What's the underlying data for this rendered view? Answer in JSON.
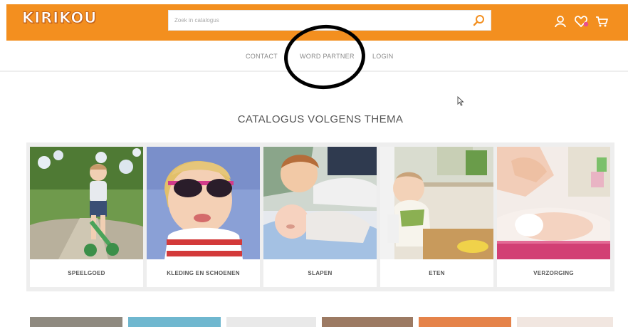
{
  "header": {
    "logo_text": "KIRIKOU",
    "search": {
      "placeholder": "Zoek in catalogus",
      "value": ""
    },
    "icons": [
      "search-icon",
      "user-icon",
      "heart-icon",
      "cart-icon"
    ],
    "brand_color": "#f38f1f"
  },
  "nav": {
    "items": [
      "CONTACT",
      "WORD PARTNER",
      "LOGIN"
    ]
  },
  "catalog": {
    "title": "CATALOGUS VOLGENS THEMA",
    "categories": [
      {
        "label": "SPEELGOED"
      },
      {
        "label": "KLEDING EN SCHOENEN"
      },
      {
        "label": "SLAPEN"
      },
      {
        "label": "ETEN"
      },
      {
        "label": "VERZORGING"
      }
    ]
  }
}
